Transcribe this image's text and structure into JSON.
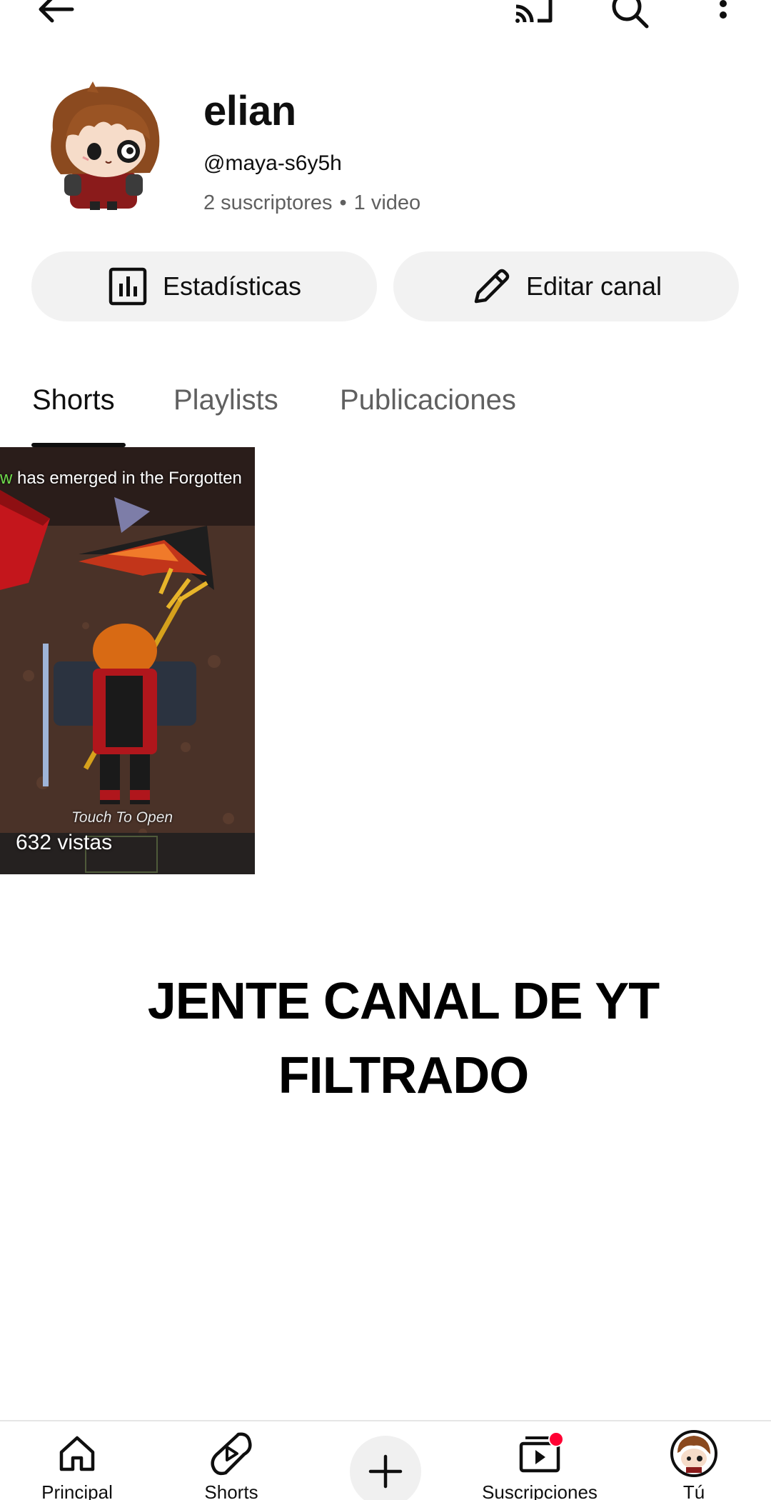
{
  "topbar": {
    "back_icon": "arrow-left-icon",
    "cast_icon": "cast-icon",
    "search_icon": "search-icon",
    "more_icon": "more-vert-icon"
  },
  "channel": {
    "name": "elian",
    "handle": "@maya-s6y5h",
    "subscribers": "2 suscriptores",
    "separator": "•",
    "videos": "1 video"
  },
  "actions": {
    "stats_label": "Estadísticas",
    "edit_label": "Editar canal"
  },
  "tabs": [
    {
      "label": "Shorts",
      "selected": true
    },
    {
      "label": "Playlists",
      "selected": false
    },
    {
      "label": "Publicaciones",
      "selected": false
    }
  ],
  "shorts": [
    {
      "views": "632 vistas",
      "banner_prefix": "w",
      "banner_text": "has emerged in the Forgotten",
      "touch_text": "Touch To Open"
    }
  ],
  "caption": {
    "line1": "JENTE CANAL DE YT",
    "line2": "FILTRADO"
  },
  "bottom_nav": {
    "home": "Principal",
    "shorts": "Shorts",
    "subscriptions": "Suscripciones",
    "you": "Tú"
  },
  "colors": {
    "accent_red": "#ff0033",
    "button_bg": "#f2f2f2",
    "muted_text": "#606060"
  }
}
